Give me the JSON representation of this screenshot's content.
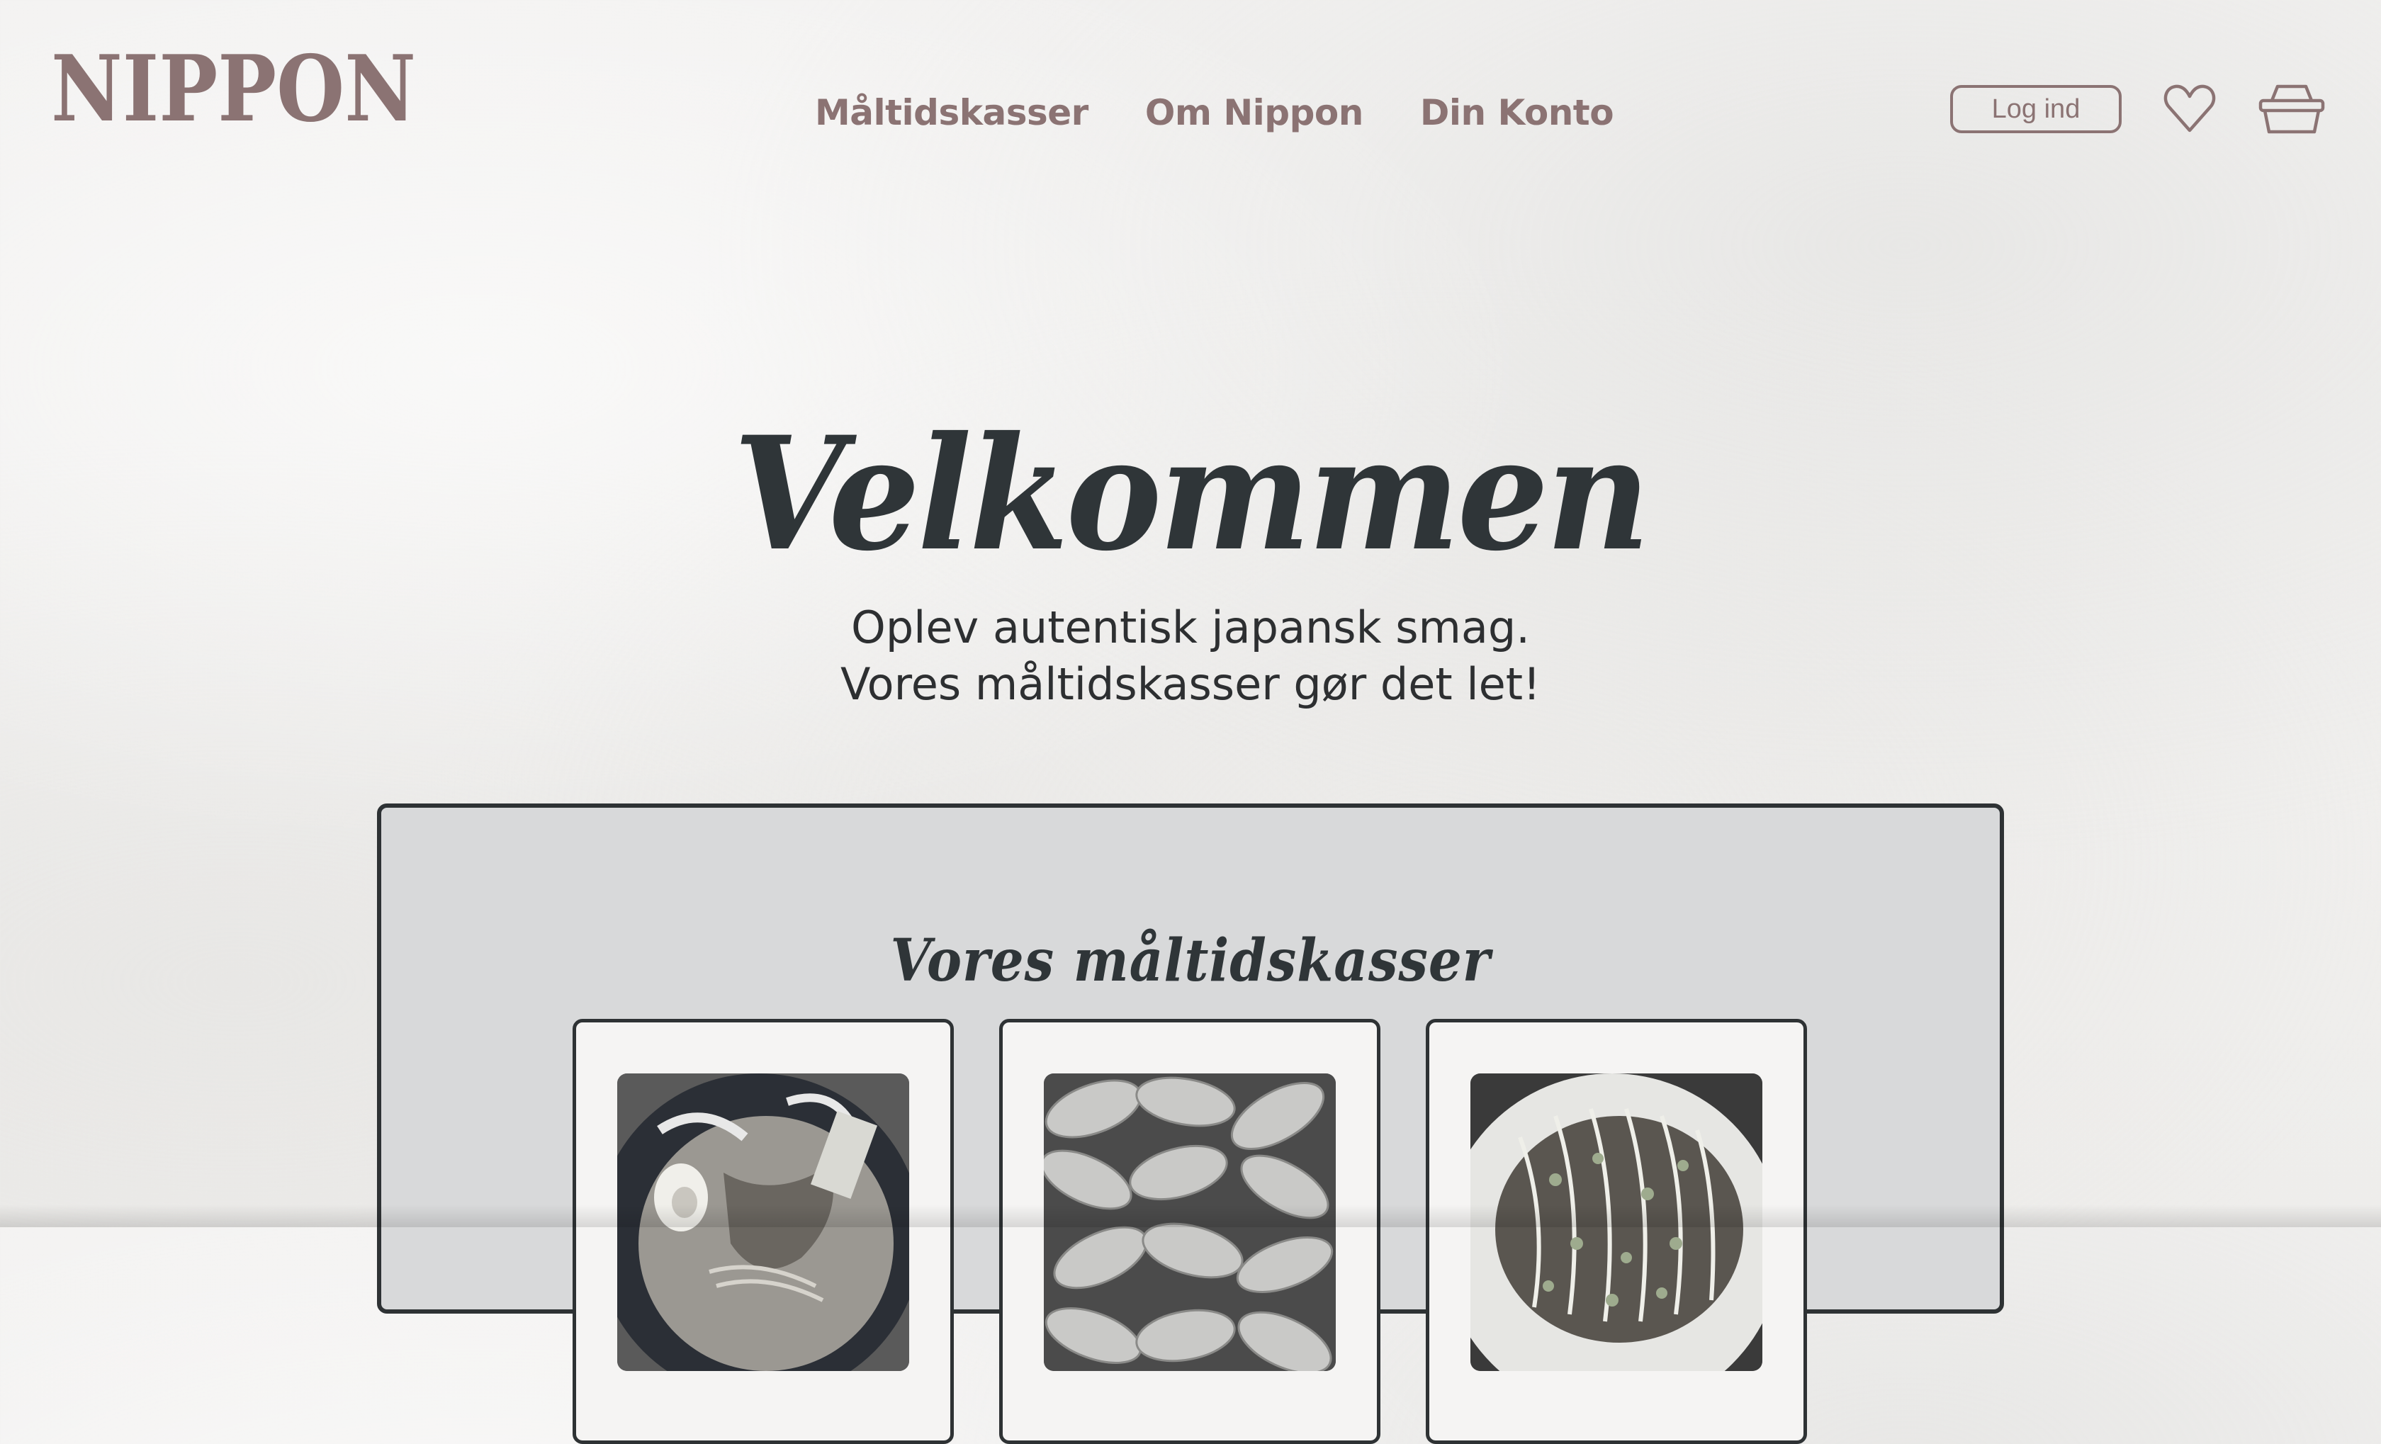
{
  "brand": {
    "logo_text": "NIPPON",
    "colors": {
      "accent": "#8b7373",
      "ink": "#2f3538",
      "panel": "#d8d9da",
      "background": "#f1f0ef"
    }
  },
  "nav": {
    "items": [
      {
        "label": "Måltidskasser"
      },
      {
        "label": "Om Nippon"
      },
      {
        "label": "Din Konto"
      }
    ]
  },
  "header_actions": {
    "login_label": "Log ind",
    "favorites_icon": "heart-icon",
    "basket_icon": "basket-icon"
  },
  "hero": {
    "title": "Velkommen",
    "subtitle_line1": "Oplev autentisk japansk smag.",
    "subtitle_line2": "Vores måltidskasser gør det let!"
  },
  "meal_boxes": {
    "title": "Vores måltidskasser",
    "cards": [
      {
        "image": "ramen-photo"
      },
      {
        "image": "gyoza-photo"
      },
      {
        "image": "okonomiyaki-photo"
      }
    ]
  }
}
